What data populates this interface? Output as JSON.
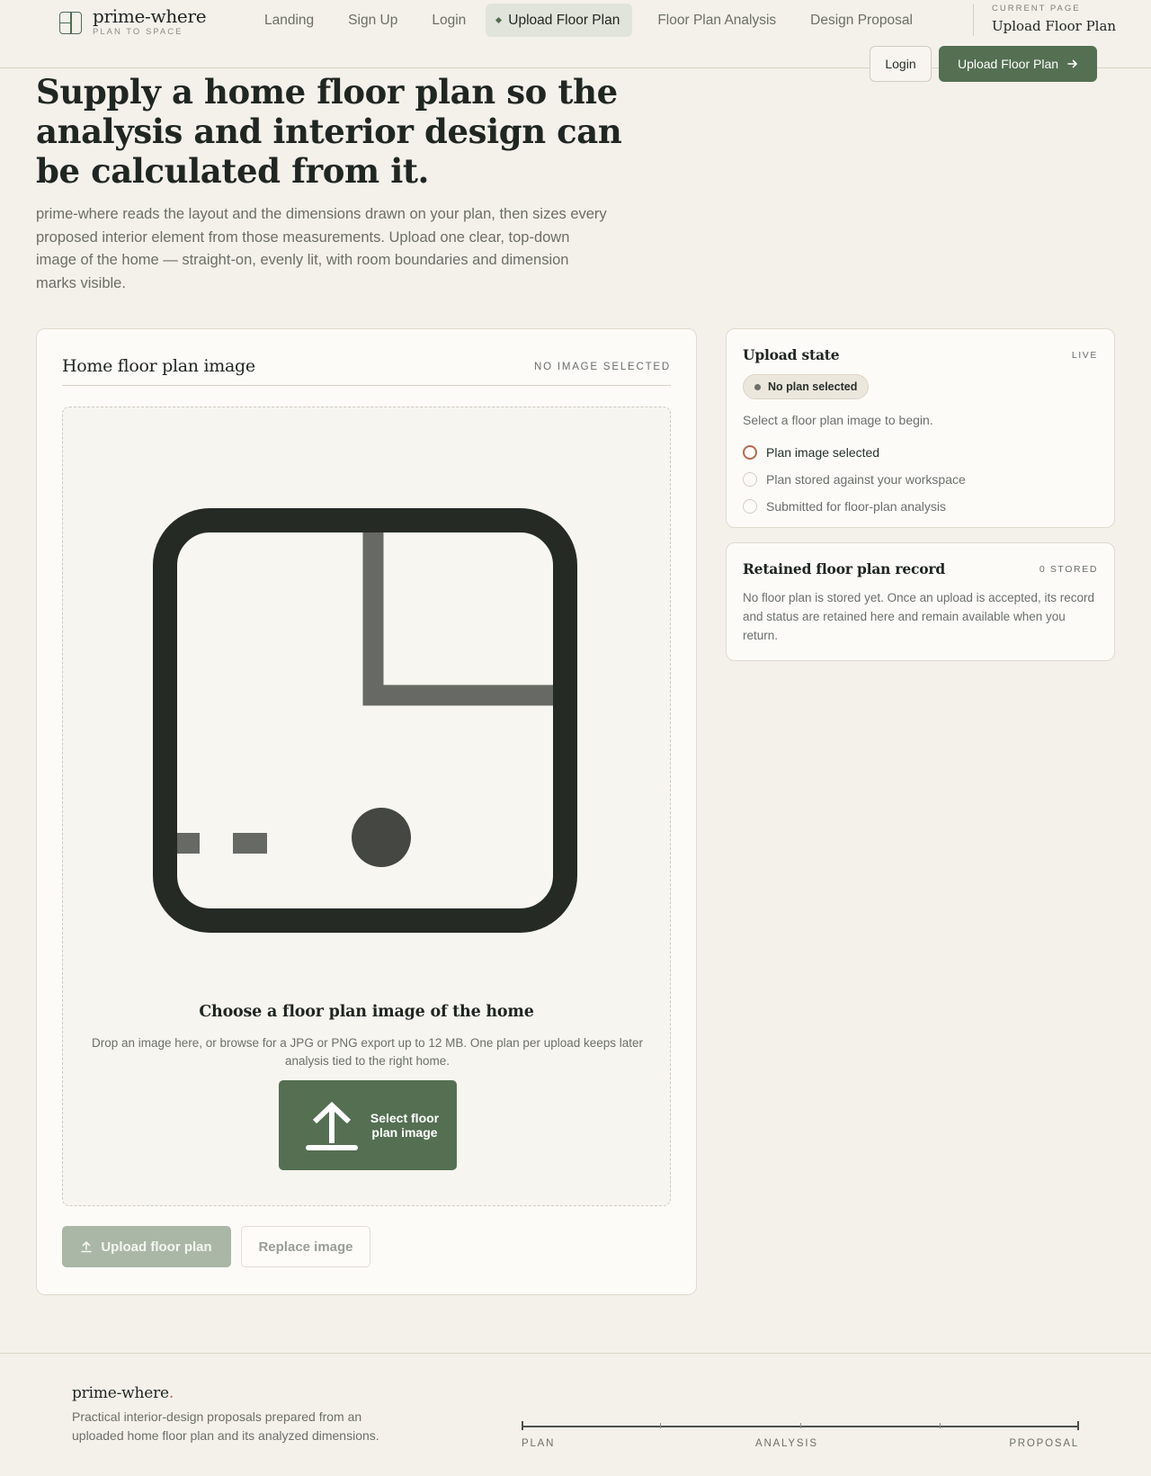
{
  "brand": {
    "name": "prime-where",
    "tagline": "PLAN TO SPACE"
  },
  "nav": {
    "links": [
      "Landing",
      "Sign Up",
      "Login",
      "Upload Floor Plan",
      "Floor Plan Analysis",
      "Design Proposal"
    ],
    "active": "Upload Floor Plan",
    "current_page_label": "CURRENT PAGE",
    "current_page_value": "Upload Floor Plan",
    "login_label": "Login",
    "cta_label": "Upload Floor Plan"
  },
  "hero": {
    "title": "Supply a home floor plan so the analysis and interior design can be calculated from it.",
    "lead": "prime-where reads the layout and the dimensions drawn on your plan, then sizes every proposed interior element from those measurements. Upload one clear, top-down image of the home — straight-on, evenly lit, with room boundaries and dimension marks visible."
  },
  "upload": {
    "title": "Home floor plan image",
    "status": "NO IMAGE SELECTED",
    "drop_title": "Choose a floor plan image of the home",
    "drop_help": "Drop an image here, or browse for a JPG or PNG export up to 12 MB. One plan per upload keeps later analysis tied to the right home.",
    "select_label": "Select floor plan image",
    "upload_label": "Upload floor plan",
    "replace_label": "Replace image"
  },
  "state": {
    "title": "Upload state",
    "tag": "LIVE",
    "pill": "No plan selected",
    "hint": "Select a floor plan image to begin.",
    "steps": [
      "Plan image selected",
      "Plan stored against your workspace",
      "Submitted for floor-plan analysis"
    ]
  },
  "record": {
    "title": "Retained floor plan record",
    "tag": "0 STORED",
    "text": "No floor plan is stored yet. Once an upload is accepted, its record and status are retained here and remain available when you return."
  },
  "footer": {
    "brand": "prime-where",
    "brand_accent": ".",
    "text": "Practical interior-design proposals prepared from an uploaded home floor plan and its analyzed dimensions.",
    "stages": [
      "PLAN",
      "ANALYSIS",
      "PROPOSAL"
    ]
  },
  "colors": {
    "accent": "#546f52",
    "background": "#f4f0ea",
    "highlight": "#b66a4c"
  },
  "icons": {
    "brand": "floor-plan-icon",
    "cta": "arrow-right-icon",
    "select": "upload-arrow-icon",
    "upload": "upload-small-icon",
    "plan": "floor-plan-illustration"
  }
}
